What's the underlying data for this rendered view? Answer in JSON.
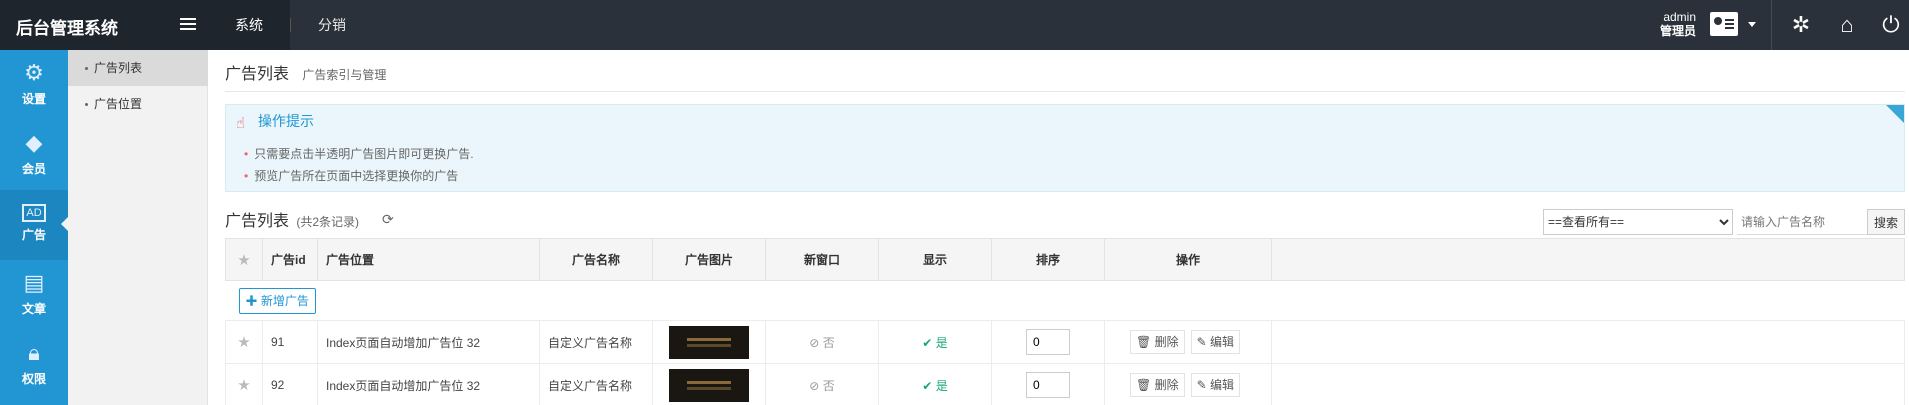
{
  "app": {
    "title": "后台管理系统"
  },
  "topnav": {
    "items": [
      "系统",
      "分销"
    ]
  },
  "user": {
    "name": "admin",
    "role": "管理员"
  },
  "sidebar": {
    "items": [
      {
        "label": "设置",
        "icon": "gear-icon"
      },
      {
        "label": "会员",
        "icon": "diamond-icon"
      },
      {
        "label": "广告",
        "icon": "ad-icon"
      },
      {
        "label": "文章",
        "icon": "document-icon"
      },
      {
        "label": "权限",
        "icon": "lock-icon"
      }
    ]
  },
  "subnav": {
    "items": [
      "广告列表",
      "广告位置"
    ]
  },
  "page": {
    "title": "广告列表",
    "subtitle": "广告索引与管理"
  },
  "tips": {
    "title": "操作提示",
    "items": [
      "只需要点击半透明广告图片即可更换广告.",
      "预览广告所在页面中选择更换你的广告"
    ]
  },
  "list": {
    "title": "广告列表",
    "count": "(共2条记录)",
    "filter_value": "==查看所有==",
    "search_placeholder": "请输入广告名称",
    "search_label": "搜索",
    "add_label": "新增广告"
  },
  "table": {
    "headers": [
      "广告id",
      "广告位置",
      "广告名称",
      "广告图片",
      "新窗口",
      "显示",
      "排序",
      "操作"
    ],
    "rows": [
      {
        "id": "91",
        "position": "Index页面自动增加广告位 32",
        "name": "自定义广告名称",
        "new_window": "否",
        "show": "是",
        "sort": "0"
      },
      {
        "id": "92",
        "position": "Index页面自动增加广告位 32",
        "name": "自定义广告名称",
        "new_window": "否",
        "show": "是",
        "sort": "0"
      }
    ],
    "delete_label": "删除",
    "edit_label": "编辑"
  },
  "colors": {
    "topbar": "#2b313a",
    "sidebar": "#2196d3",
    "accent": "#2196d3",
    "success": "#1aa57a"
  }
}
